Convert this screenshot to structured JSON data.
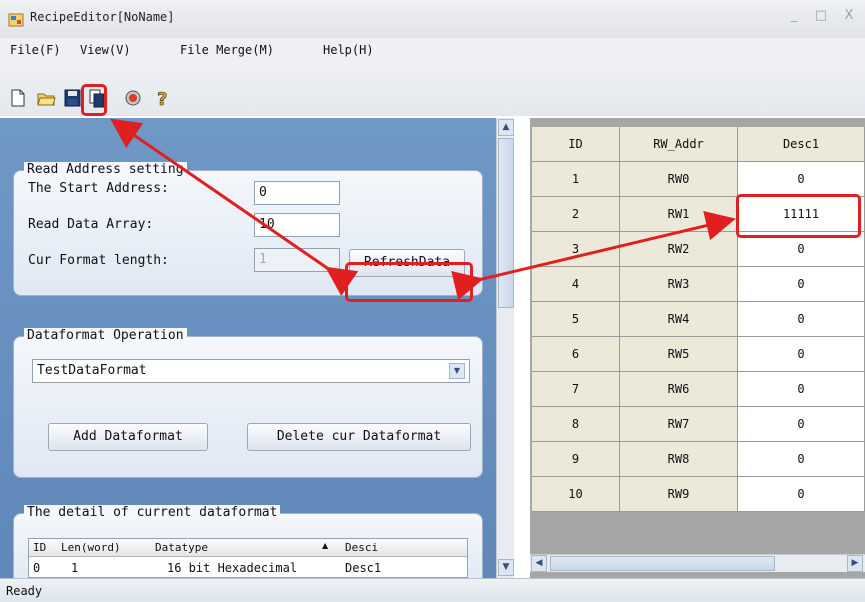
{
  "window": {
    "title": "RecipeEditor[NoName]",
    "minimize": "_",
    "maximize": "□",
    "close": "X"
  },
  "menu": [
    "File(F)",
    "View(V)",
    "File Merge(M)",
    "Help(H)"
  ],
  "toolbar": [
    "new-file-icon",
    "open-folder-icon",
    "save-icon",
    "copy-icon",
    "record-icon",
    "help-icon"
  ],
  "read_address": {
    "title": "Read Address setting",
    "start_label": "The Start Address:",
    "start_value": "0",
    "array_label": "Read Data Array:",
    "array_value": "10",
    "format_label": "Cur Format length:",
    "format_value": "1",
    "refresh_label": "RefreshData"
  },
  "dataformat": {
    "title": "Dataformat Operation",
    "selected": "TestDataFormat",
    "add_label": "Add Dataformat",
    "delete_label": "Delete cur Dataformat"
  },
  "detail": {
    "title": "The detail of current dataformat",
    "columns": [
      "ID",
      "Len(word)",
      "Datatype",
      "Desci"
    ],
    "rows": [
      [
        "0",
        "1",
        "16 bit Hexadecimal",
        "Desc1"
      ]
    ]
  },
  "grid": {
    "columns": [
      "ID",
      "RW_Addr",
      "Desc1"
    ],
    "rows": [
      [
        "1",
        "RW0",
        "0"
      ],
      [
        "2",
        "RW1",
        "11111"
      ],
      [
        "3",
        "RW2",
        "0"
      ],
      [
        "4",
        "RW3",
        "0"
      ],
      [
        "5",
        "RW4",
        "0"
      ],
      [
        "6",
        "RW5",
        "0"
      ],
      [
        "7",
        "RW6",
        "0"
      ],
      [
        "8",
        "RW7",
        "0"
      ],
      [
        "9",
        "RW8",
        "0"
      ],
      [
        "10",
        "RW9",
        "0"
      ]
    ]
  },
  "status": "Ready",
  "colors": {
    "annotation": "#e02020",
    "panel": "#6f98c6",
    "grid_header": "#ece9d8"
  }
}
